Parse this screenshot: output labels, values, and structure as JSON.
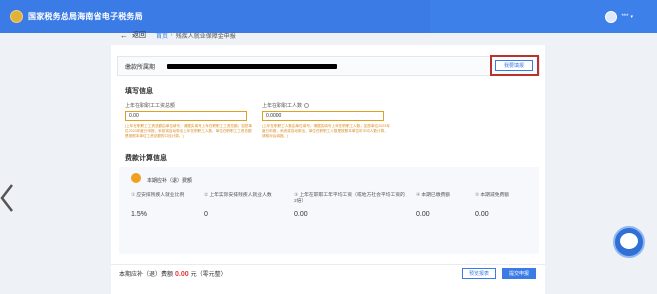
{
  "header": {
    "title": "国家税务总局海南省电子税务局",
    "user_name": "***",
    "user_caret": "▾"
  },
  "nav": {
    "back_label": "返回",
    "breadcrumb": [
      "首页",
      "残疾人就业保障金申报"
    ],
    "separator": "/"
  },
  "unit": {
    "label": "缴款所属期",
    "button_label": "我要填报"
  },
  "fill_section": {
    "title": "填写信息",
    "fields": [
      {
        "label": "上年在职职工工资总额",
        "value": "0.00",
        "note": "(上年在职职工工资总额由单位填写，请据实填写上年在职职工工资总额；如您单位2023年度已申报，系统将自动带出上年在职职工人数，单位在职职工工资总额是按照本单位工资总额的口径计算。)"
      },
      {
        "label": "上年在职职工人数",
        "value": "0.0000",
        "note": "(上年在职职工人数由单位填写，请据实填写上年在职职工人数；如您单位2023年度已申报，系统将自动带出，单位在职职工人数是按照本单位年平均人数计算，请核对后填报。)"
      }
    ]
  },
  "calc_section": {
    "title": "费款计算信息",
    "amount_label": "本期应补（退）费额",
    "columns": [
      {
        "num": "①",
        "label": "应安排残疾人就业比例",
        "value": "1.5%"
      },
      {
        "num": "②",
        "label": "上年实际安排残疾人就业人数",
        "value": "0"
      },
      {
        "num": "③",
        "label": "上年在职职工年平均工资（或地方社会平均工资的2倍）",
        "value": "0.00"
      },
      {
        "num": "④",
        "label": "本期已缴费额",
        "value": "0.00"
      },
      {
        "num": "⑤",
        "label": "本期减免费额",
        "value": "0.00"
      }
    ]
  },
  "footer": {
    "prefix": "本期应补（退）费额",
    "amount": "0.00",
    "suffix": "元（零元整）",
    "preview_label": "预览报表",
    "submit_label": "提交申报"
  },
  "colors": {
    "primary": "#3b7be6",
    "warning": "#e0a020",
    "highlight_box": "#b8332e",
    "amount": "#e4393c"
  },
  "icons": [
    "emblem-icon",
    "avatar-icon",
    "back-arrow-icon",
    "info-icon",
    "coin-icon",
    "left-arrow-icon",
    "mascot-icon"
  ]
}
